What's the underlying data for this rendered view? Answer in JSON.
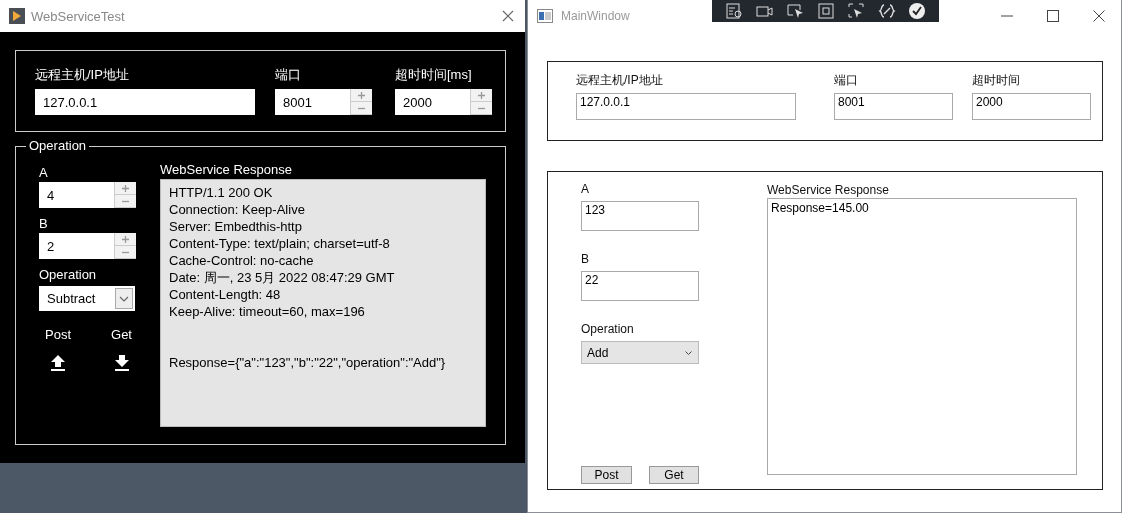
{
  "left_window": {
    "title": "WebServiceTest",
    "config_fields": [
      {
        "label": "远程主机/IP地址",
        "value": "127.0.0.1",
        "kind": "text"
      },
      {
        "label": "端口",
        "value": "8001",
        "kind": "spinner"
      },
      {
        "label": "超时时间[ms]",
        "value": "2000",
        "kind": "spinner"
      }
    ],
    "operation_group": {
      "title": "Operation",
      "inputs": [
        {
          "label": "A",
          "value": "4"
        },
        {
          "label": "B",
          "value": "2"
        }
      ],
      "operation": {
        "label": "Operation",
        "value": "Subtract"
      },
      "actions": [
        {
          "label": "Post",
          "kind": "upload"
        },
        {
          "label": "Get",
          "kind": "download"
        }
      ],
      "response": {
        "label": "WebService Response",
        "text": "HTTP/1.1 200 OK\nConnection: Keep-Alive\nServer: Embedthis-http\nContent-Type: text/plain; charset=utf-8\nCache-Control: no-cache\nDate: 周一, 23 5月 2022 08:47:29 GMT\nContent-Length: 48\nKeep-Alive: timeout=60, max=196\n\n\nResponse={\"a\":\"123\",\"b\":\"22\",\"operation\":\"Add\"}"
      }
    }
  },
  "right_window": {
    "title": "MainWindow",
    "debug_toolbar": [
      {
        "kind": "inspect"
      },
      {
        "kind": "camera"
      },
      {
        "kind": "select"
      },
      {
        "kind": "frame"
      },
      {
        "kind": "target"
      },
      {
        "kind": "binding"
      },
      {
        "kind": "check"
      }
    ],
    "config_fields": [
      {
        "label": "远程主机/IP地址",
        "value": "127.0.0.1"
      },
      {
        "label": "端口",
        "value": "8001"
      },
      {
        "label": "超时时间",
        "value": "2000"
      }
    ],
    "inputs": [
      {
        "label": "A",
        "value": "123"
      },
      {
        "label": "B",
        "value": "22"
      }
    ],
    "operation": {
      "label": "Operation",
      "value": "Add"
    },
    "buttons": [
      {
        "label": "Post"
      },
      {
        "label": "Get"
      }
    ],
    "response": {
      "label": "WebService Response",
      "text": "Response=145.00"
    }
  }
}
